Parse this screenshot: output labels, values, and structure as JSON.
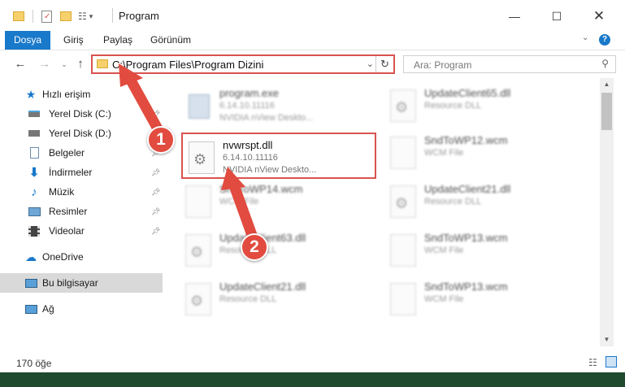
{
  "window": {
    "title": "Program"
  },
  "ribbon": {
    "tabs": [
      "Dosya",
      "Giriş",
      "Paylaş",
      "Görünüm"
    ]
  },
  "address": {
    "path": "C:\\Program Files\\Program Dizini"
  },
  "search": {
    "placeholder": "Ara: Program"
  },
  "sidebar": {
    "items": [
      {
        "label": "Hızlı erişim"
      },
      {
        "label": "Yerel Disk (C:)"
      },
      {
        "label": "Yerel Disk (D:)"
      },
      {
        "label": "Belgeler"
      },
      {
        "label": "İndirmeler"
      },
      {
        "label": "Müzik"
      },
      {
        "label": "Resimler"
      },
      {
        "label": "Videolar"
      },
      {
        "label": "OneDrive"
      },
      {
        "label": "Bu bilgisayar"
      },
      {
        "label": "Ağ"
      }
    ]
  },
  "files": [
    {
      "name": "program.exe",
      "sub": "6.14.10.11116",
      "sub2": "NVIDIA nView Deskto..."
    },
    {
      "name": "UpdateClient65.dll",
      "sub": "Resource DLL",
      "sub2": ""
    },
    {
      "name": "nvwrspt.dll",
      "sub": "6.14.10.11116",
      "sub2": "NVIDIA nView Deskto..."
    },
    {
      "name": "SndToWP12.wcm",
      "sub": "WCM File",
      "sub2": ""
    },
    {
      "name": "SndToWP14.wcm",
      "sub": "WCM File",
      "sub2": ""
    },
    {
      "name": "UpdateClient21.dll",
      "sub": "Resource DLL",
      "sub2": ""
    },
    {
      "name": "UpdateClient63.dll",
      "sub": "Resource DLL",
      "sub2": ""
    },
    {
      "name": "SndToWP13.wcm",
      "sub": "WCM File",
      "sub2": ""
    },
    {
      "name": "UpdateClient21.dll",
      "sub": "Resource DLL",
      "sub2": ""
    },
    {
      "name": "SndToWP13.wcm",
      "sub": "WCM File",
      "sub2": ""
    }
  ],
  "status": {
    "count": "170 öğe"
  },
  "callouts": {
    "one": "1",
    "two": "2"
  },
  "colors": {
    "accent": "#1979ca",
    "highlight": "#d9534f",
    "callout": "#e24b3f"
  }
}
